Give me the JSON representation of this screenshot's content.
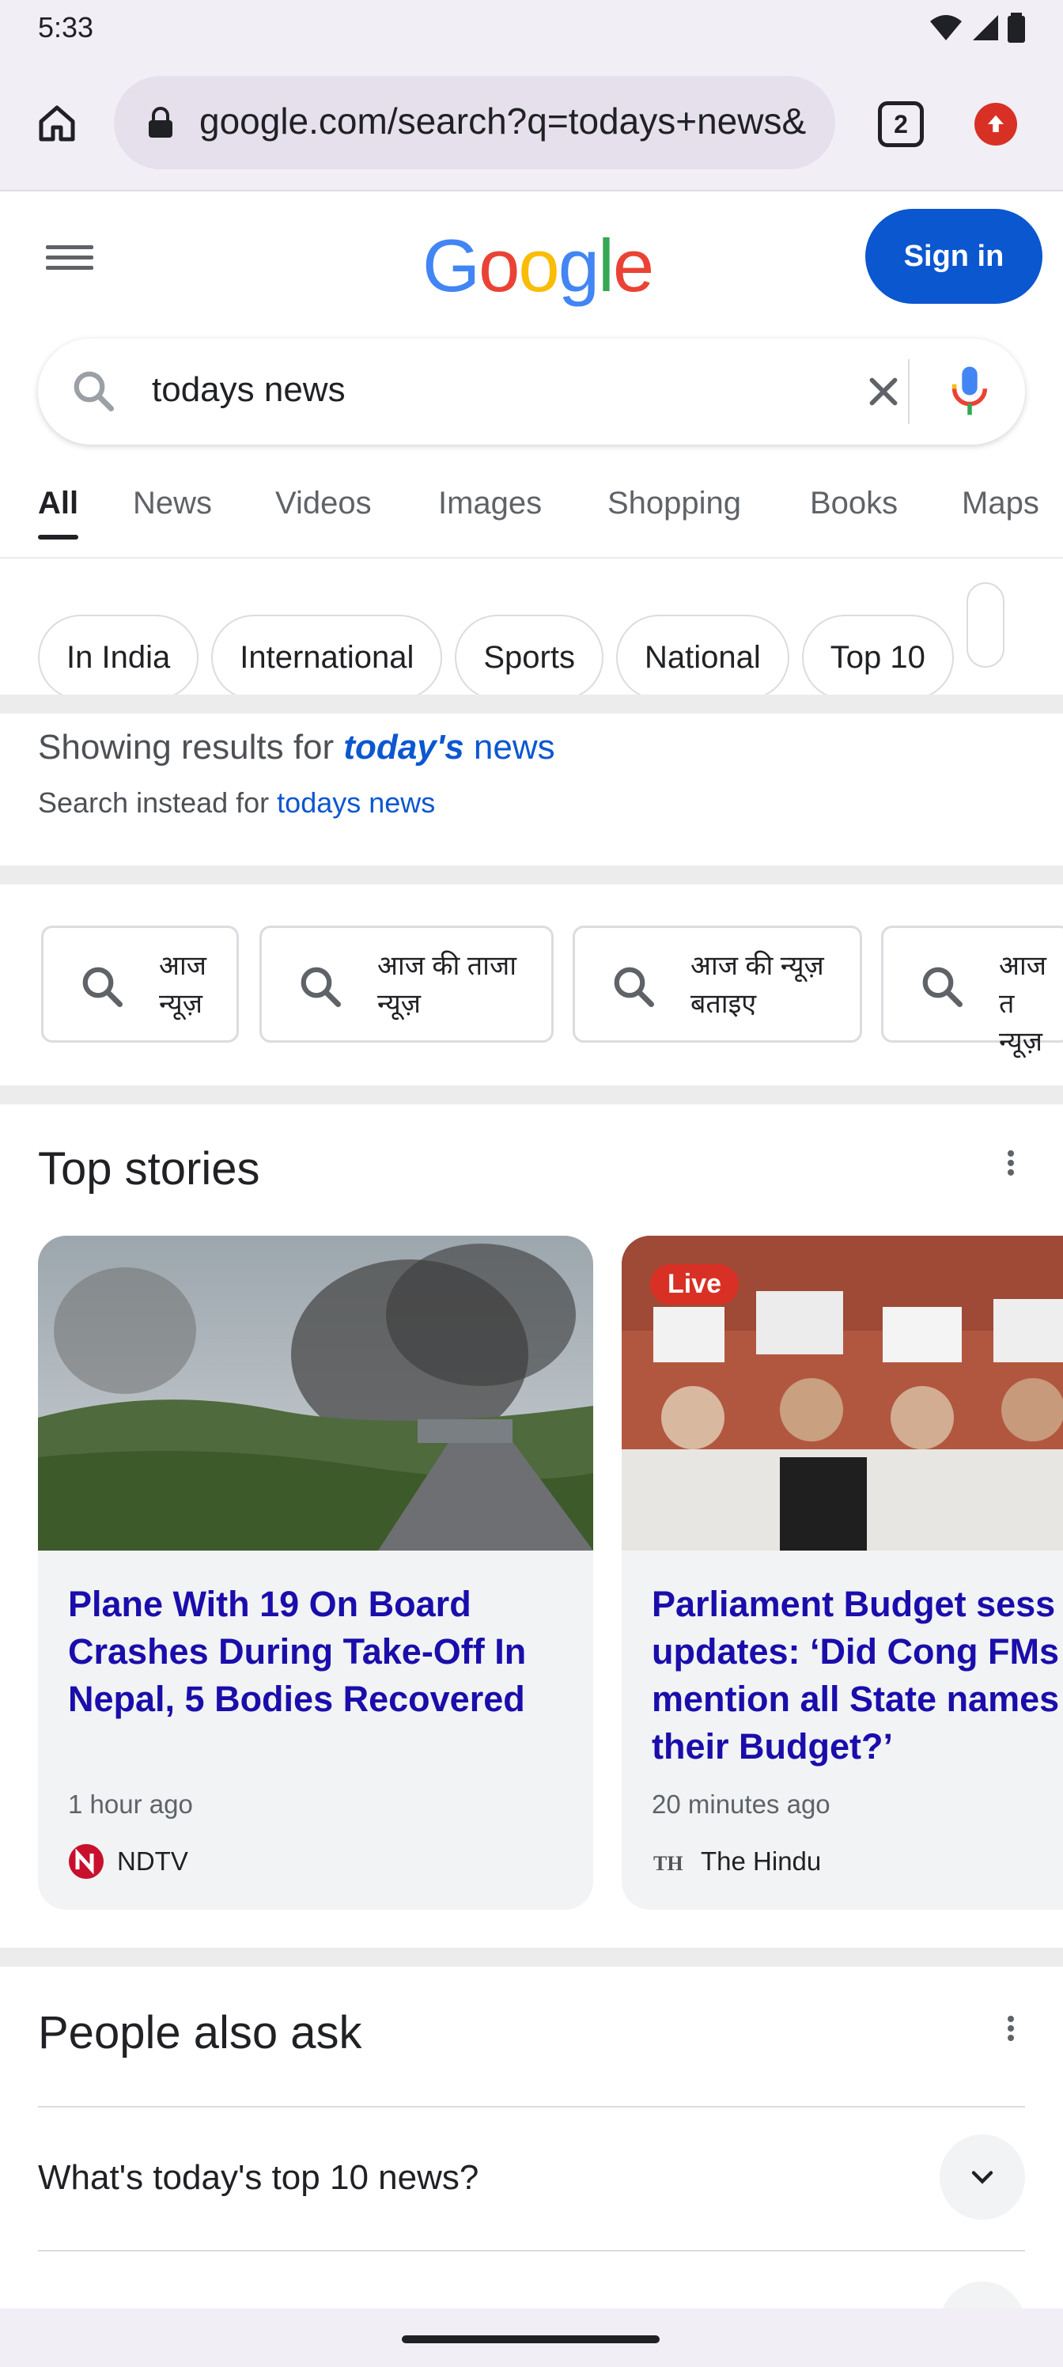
{
  "status_bar": {
    "time": "5:33"
  },
  "browser": {
    "url": "google.com/search?q=todays+news&",
    "tab_count": "2",
    "icons": [
      "home-icon",
      "lock-icon",
      "update-icon"
    ]
  },
  "header": {
    "logo": [
      "G",
      "o",
      "o",
      "g",
      "l",
      "e"
    ],
    "logo_colors": [
      "#4285F4",
      "#EA4335",
      "#FBBC05",
      "#4285F4",
      "#34A853",
      "#EA4335"
    ],
    "signin_label": "Sign in"
  },
  "search": {
    "query": "todays news"
  },
  "tabs": [
    "All",
    "News",
    "Videos",
    "Images",
    "Shopping",
    "Books",
    "Maps"
  ],
  "chips": [
    "In India",
    "International",
    "Sports",
    "National",
    "Top 10"
  ],
  "correction": {
    "prefix": "Showing results for ",
    "corrected_bold": "today's",
    "corrected_rest": " news",
    "instead_prefix": "Search instead for ",
    "instead_link": "todays news"
  },
  "related": [
    {
      "line1": "आज",
      "line2": "न्यूज़"
    },
    {
      "line1": "आज की ताजा",
      "line2": "न्यूज़"
    },
    {
      "line1": "आज की न्यूज़",
      "line2": "बताइए"
    },
    {
      "line1": "आज त",
      "line2": "न्यूज़"
    }
  ],
  "top_stories": {
    "title": "Top stories",
    "cards": [
      {
        "headline": "Plane With 19 On Board Crashes During Take-Off In Nepal, 5 Bodies Recovered",
        "time": "1 hour ago",
        "source": "NDTV",
        "live": ""
      },
      {
        "headline": "Parliament Budget sess LIVE updates: ‘Did Cong FMs mention all State names in their Budget?’",
        "time": "20 minutes ago",
        "source": "The Hindu",
        "live": "Live"
      }
    ]
  },
  "paa": {
    "title": "People also ask",
    "questions": [
      "What's today's top 10 news?"
    ]
  },
  "colors": {
    "link": "#1a0dab",
    "accent": "#0b57d0",
    "live": "#d93025"
  }
}
